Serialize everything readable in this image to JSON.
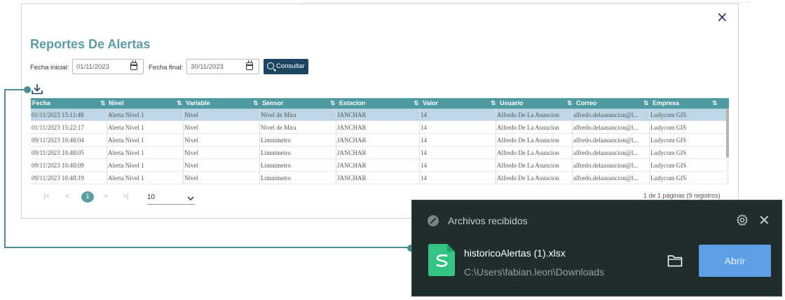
{
  "dialog": {
    "title": "Reportes De Alertas",
    "close": "×",
    "filters": {
      "start_label": "Fecha inicial:",
      "start_value": "01/11/2023",
      "end_label": "Fecha final:",
      "end_value": "30/11/2023",
      "consult_label": "Consultar"
    },
    "table": {
      "columns": [
        "Fecha",
        "Nivel",
        "Variable",
        "Sensor",
        "Estacion",
        "Valor",
        "Usuario",
        "Correo",
        "Empresa"
      ],
      "rows": [
        [
          "01/11/2023 15:11:48",
          "Alerta Nivel 1",
          "Nivel",
          "Nivel de Mira",
          "JANCHAR",
          "14",
          "Alfredo De La Asuncion",
          "alfredo.delaasuncion@l...",
          "Ludycom GIS"
        ],
        [
          "01/11/2023 15:22:17",
          "Alerta Nivel 1",
          "Nivel",
          "Nivel de Mira",
          "JANCHAR",
          "14",
          "Alfredo De La Asuncion",
          "alfredo.delaasuncion@l...",
          "Ludycom GIS"
        ],
        [
          "09/11/2023 10:48:04",
          "Alerta Nivel 1",
          "Nivel",
          "Limnimetro",
          "JANCHAR",
          "14",
          "Alfredo De La Asuncion",
          "alfredo.delaasuncion@l...",
          "Ludycom GIS"
        ],
        [
          "09/11/2023 10:48:05",
          "Alerta Nivel 1",
          "Nivel",
          "Limnimetro",
          "JANCHAR",
          "14",
          "Alfredo De La Asuncion",
          "alfredo.delaasuncion@l...",
          "Ludycom GIS"
        ],
        [
          "09/11/2023 10:48:09",
          "Alerta Nivel 1",
          "Nivel",
          "Limnimetro",
          "JANCHAR",
          "14",
          "Alfredo De La Asuncion",
          "alfredo.delaasuncion@l...",
          "Ludycom GIS"
        ],
        [
          "09/11/2023 10:48:19",
          "Alerta Nivel 1",
          "Nivel",
          "Limnimetro",
          "JANCHAR",
          "14",
          "Alfredo De La Asuncion",
          "alfredo.delaasuncion@l...",
          "Ludycom GIS"
        ]
      ],
      "selected_row": 0
    },
    "pager": {
      "first": "|<",
      "prev": "<",
      "current": "1",
      "next": ">",
      "last": ">|",
      "page_size": "10",
      "info": "1 de 1 páginas (9 registros)"
    }
  },
  "downloads": {
    "title": "Archivos recibidos",
    "file_name": "historicoAlertas (1).xlsx",
    "file_path": "C:\\Users\\fabian.leon\\Downloads",
    "open_label": "Abrir",
    "close": "✕",
    "accent": "#5d9ee5",
    "file_icon_color": "#33c481"
  },
  "icons": {
    "date_picker": "calendar-icon",
    "consult": "search-icon",
    "export": "download-icon",
    "sort": "sort-icon",
    "settings": "gear-icon",
    "folder": "folder-icon",
    "spreadsheet": "spreadsheet-icon"
  }
}
